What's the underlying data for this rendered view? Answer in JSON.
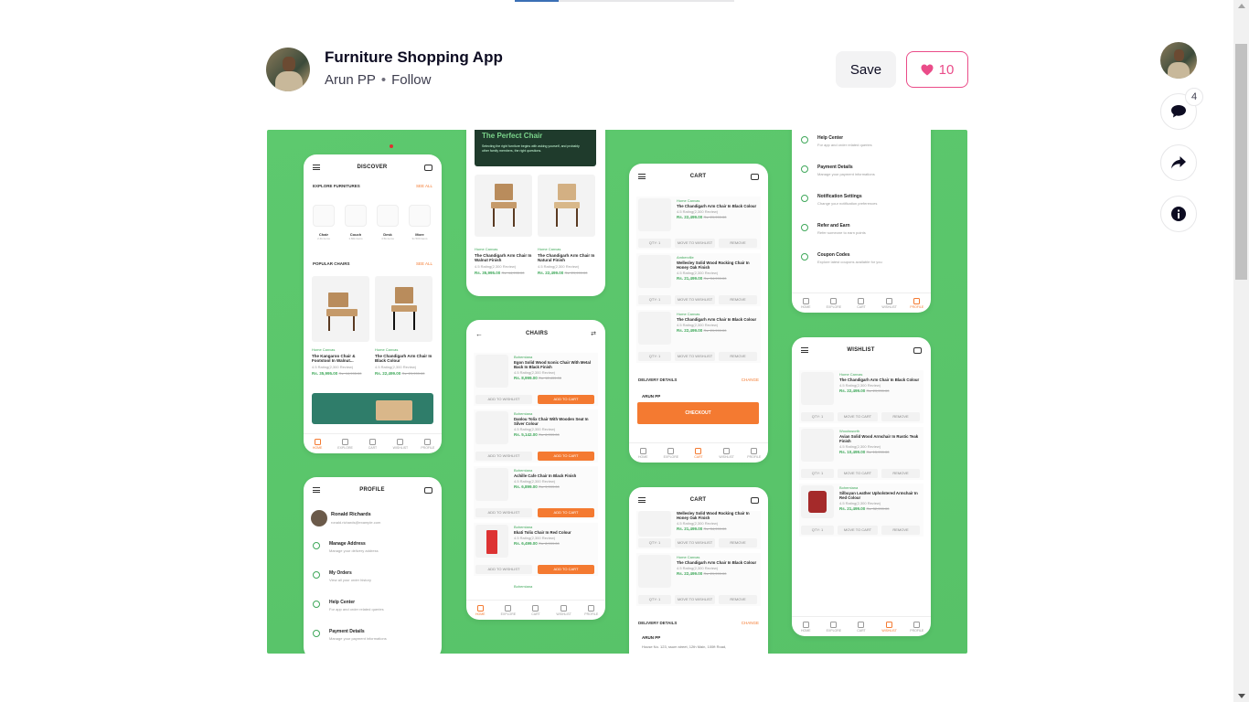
{
  "shot": {
    "title": "Furniture Shopping App",
    "author": "Arun PP",
    "separator": "•",
    "follow_label": "Follow",
    "save_label": "Save",
    "like_count": "10",
    "comment_count": "4"
  },
  "colors": {
    "accent_pink": "#ea4c89",
    "shot_background": "#57c268",
    "app_orange": "#f47a31",
    "app_green": "#3fa85a"
  },
  "icons": {
    "like": "heart-icon",
    "comments": "comment-icon",
    "share": "share-icon",
    "info": "info-icon"
  },
  "mockup": {
    "discover": {
      "title": "DISCOVER",
      "explore_label": "EXPLORE FURNITURES",
      "see_all": "SEE ALL",
      "categories": [
        {
          "name": "Chair",
          "count": "2.4k items"
        },
        {
          "name": "Couch",
          "count": "1.60k items"
        },
        {
          "name": "Desk",
          "count": "4.5k items"
        },
        {
          "name": "More",
          "count": "3x 500 items"
        }
      ],
      "popular_label": "POPULAR CHAIRS",
      "products": [
        {
          "brand": "Home Canvas",
          "name": "The Kangaroo Chair & Footstool In Walnut...",
          "rating": "4.5 Rating(2,300 Review)",
          "price": "Rs. 35,995.00",
          "old": "Rs. 44,995.00"
        },
        {
          "brand": "Home Canvas",
          "name": "The Chandigarh Arm Chair In Black Colour",
          "rating": "4.5 Rating(2,300 Review)",
          "price": "Rs. 22,499.00",
          "old": "Rs. 29,999.00"
        }
      ]
    },
    "hero": {
      "title": "The Perfect Chair",
      "subtitle": "Selecting the right furniture begins with asking yourself, and probably other family members, the right questions.",
      "products": [
        {
          "brand": "Home Canvas",
          "name": "The Chandigarh Arm Chair In Walnut Finish",
          "rating": "4.5 Rating(2,300 Review)",
          "price": "Rs. 35,995.00",
          "old": "Rs. 44,995.00"
        },
        {
          "brand": "Home Canvas",
          "name": "The Chandigarh Arm Chair In Natural Finish",
          "rating": "4.5 Rating(2,300 Review)",
          "price": "Rs. 22,499.00",
          "old": "Rs. 29,999.00"
        }
      ]
    },
    "chairs": {
      "title": "CHAIRS",
      "wishlist_btn": "ADD TO WISHLIST",
      "cart_btn": "ADD TO CART",
      "items": [
        {
          "brand": "Bohemiana",
          "name": "Egon Solid Wood Iconic Chair With Metal Back In Black Finish",
          "rating": "4.5 Rating(2,300 Review)",
          "price": "Rs. 8,999.00",
          "old": "Rs. 12,499.00"
        },
        {
          "brand": "Bohemiana",
          "name": "Danlou Tolix Chair With Wooden Seat In Silver Colour",
          "rating": "4.5 Rating(2,300 Review)",
          "price": "Rs. 5,142.00",
          "old": "Rs. 6,999.00"
        },
        {
          "brand": "Bohemiana",
          "name": "Achille Cafe Chair In Black Finish",
          "rating": "4.5 Rating(2,300 Review)",
          "price": "Rs. 6,899.00",
          "old": "Rs. 9,999.00"
        },
        {
          "brand": "Bohemiana",
          "name": "Ekati Tolix Chair In Red Colour",
          "rating": "4.5 Rating(2,300 Review)",
          "price": "Rs. 6,499.00",
          "old": "Rs. 8,999.00"
        }
      ],
      "last_brand": "Bohemiana"
    },
    "cart": {
      "title": "CART",
      "qty": "QTY: 1",
      "move_btn": "MOVE TO WISHLIST",
      "remove_btn": "REMOVE",
      "items": [
        {
          "brand": "Home Canvas",
          "name": "The Chandigarh Arm Chair In Black Colour",
          "rating": "4.5 Rating(2,300 Review)",
          "price": "Rs. 22,499.00",
          "old": "Rs. 29,999.00"
        },
        {
          "brand": "Amberville",
          "name": "Wellesley Solid Wood Rocking Chair In Honey Oak Finish",
          "rating": "4.5 Rating(2,300 Review)",
          "price": "Rs. 21,499.00",
          "old": "Rs. 34,999.00"
        },
        {
          "brand": "Home Canvas",
          "name": "The Chandigarh Arm Chair In Black Colour",
          "rating": "4.5 Rating(2,300 Review)",
          "price": "Rs. 22,499.00",
          "old": "Rs. 29,999.00"
        }
      ],
      "delivery_label": "DELIVERY DETAILS",
      "change_label": "CHANGE",
      "customer": "ARUN PP",
      "checkout": "CHECKOUT"
    },
    "cart2": {
      "title": "CART",
      "items": [
        {
          "name": "Wellesley Solid Wood Rocking Chair In Honey Oak Finish",
          "rating": "4.5 Rating(2,300 Review)",
          "price": "Rs. 21,499.00",
          "old": "Rs. 34,999.00"
        },
        {
          "brand": "Home Canvas",
          "name": "The Chandigarh Arm Chair In Black Colour",
          "rating": "4.5 Rating(2,300 Review)",
          "price": "Rs. 22,499.00",
          "old": "Rs. 29,999.00"
        }
      ],
      "delivery_label": "DELIVERY DETAILS",
      "change_label": "CHANGE",
      "customer": "ARUN PP",
      "address": "House No. 123, ssum street, 12th Main, 100ft Road,"
    },
    "profile": {
      "title": "PROFILE",
      "name": "Ronald Richards",
      "email": "ronald.richards@example.com",
      "menu": [
        {
          "label": "Manage Address",
          "sub": "Manage your delivery address"
        },
        {
          "label": "My Orders",
          "sub": "View all your order history"
        },
        {
          "label": "Help Center",
          "sub": "For app and order related queries"
        },
        {
          "label": "Payment Details",
          "sub": "Manage your payment informations"
        }
      ]
    },
    "profile_top": {
      "menu": [
        {
          "label": "Help Center",
          "sub": "For app and order related queries"
        },
        {
          "label": "Payment Details",
          "sub": "Manage your payment informations"
        },
        {
          "label": "Notification Settings",
          "sub": "Change your notification preferences"
        },
        {
          "label": "Refer and Earn",
          "sub": "Refer someone to earn points"
        },
        {
          "label": "Coupon Codes",
          "sub": "Explore latest coupons available for you"
        }
      ]
    },
    "wishlist": {
      "title": "WISHLIST",
      "items": [
        {
          "brand": "Home Canvas",
          "name": "The Chandigarh Arm Chair In Black Colour",
          "rating": "4.5 Rating(2,300 Review)",
          "price": "Rs. 22,499.00",
          "old": "Rs. 29,999.00"
        },
        {
          "brand": "Woodsworth",
          "name": "Avian Solid Wood Armchair In Rustic Teak Finish",
          "rating": "4.5 Rating(2,300 Review)",
          "price": "Rs. 10,499.00",
          "old": "Rs. 15,999.00"
        },
        {
          "brand": "Bohemiana",
          "name": "Silbuyan Leather Upholstered Armchair In Red Colour",
          "rating": "4.5 Rating(2,300 Review)",
          "price": "Rs. 21,499.00",
          "old": "Rs. 32,999.00"
        }
      ],
      "move_btn": "MOVE TO CART",
      "remove_btn": "REMOVE",
      "qty": "QTY: 1"
    },
    "nav": [
      "HOME",
      "EXPLORE",
      "CART",
      "WISHLIST",
      "PROFILE"
    ]
  }
}
